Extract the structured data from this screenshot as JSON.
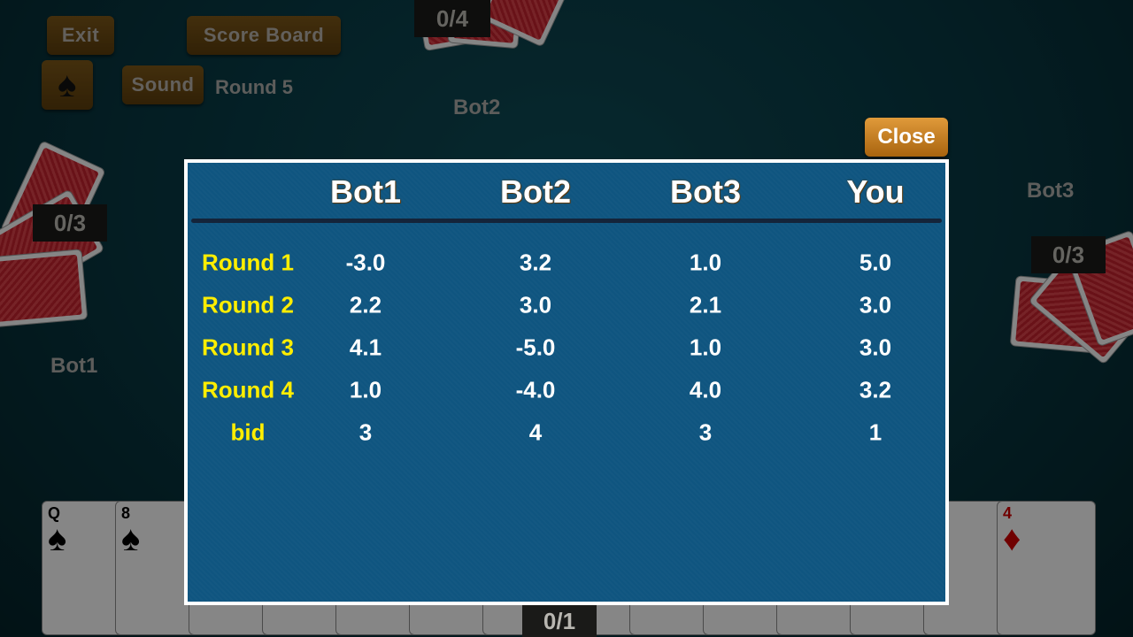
{
  "toolbar": {
    "exit": "Exit",
    "score_board": "Score Board",
    "sound": "Sound",
    "round": "Round 5"
  },
  "players": {
    "bot1": {
      "name": "Bot1",
      "tricks": "0/3"
    },
    "bot2": {
      "name": "Bot2",
      "tricks": "0/4"
    },
    "bot3": {
      "name": "Bot3",
      "tricks": "0/3"
    },
    "you": {
      "tricks": "0/1"
    }
  },
  "hand": [
    {
      "rank": "Q",
      "suit": "♠",
      "color": "#000"
    },
    {
      "rank": "8",
      "suit": "♠",
      "color": "#000"
    },
    {
      "rank": "",
      "suit": "♠",
      "color": "#000"
    },
    {
      "rank": "",
      "suit": "♠",
      "color": "#000"
    },
    {
      "rank": "",
      "suit": "♥",
      "color": "#c00"
    },
    {
      "rank": "",
      "suit": "♥",
      "color": "#c00"
    },
    {
      "rank": "",
      "suit": "♣",
      "color": "#000"
    },
    {
      "rank": "",
      "suit": "♣",
      "color": "#000"
    },
    {
      "rank": "",
      "suit": "♣",
      "color": "#000"
    },
    {
      "rank": "",
      "suit": "♦",
      "color": "#c00"
    },
    {
      "rank": "",
      "suit": "♦",
      "color": "#c00"
    },
    {
      "rank": "",
      "suit": "♦",
      "color": "#c00"
    },
    {
      "rank": "",
      "suit": "♦",
      "color": "#c00"
    },
    {
      "rank": "4",
      "suit": "♦",
      "color": "#c00"
    }
  ],
  "scoreboard": {
    "close": "Close",
    "headers": [
      "Bot1",
      "Bot2",
      "Bot3",
      "You"
    ],
    "rows": [
      {
        "label": "Round 1",
        "values": [
          "-3.0",
          "3.2",
          "1.0",
          "5.0"
        ]
      },
      {
        "label": "Round 2",
        "values": [
          "2.2",
          "3.0",
          "2.1",
          "3.0"
        ]
      },
      {
        "label": "Round 3",
        "values": [
          "4.1",
          "-5.0",
          "1.0",
          "3.0"
        ]
      },
      {
        "label": "Round 4",
        "values": [
          "1.0",
          "-4.0",
          "4.0",
          "3.2"
        ]
      },
      {
        "label": "bid",
        "values": [
          "3",
          "4",
          "3",
          "1"
        ]
      }
    ]
  },
  "colors": {
    "panel": "#0f5580",
    "row_label": "#ffee00",
    "button": "#7a5618",
    "close_button": "#d08a2a"
  }
}
